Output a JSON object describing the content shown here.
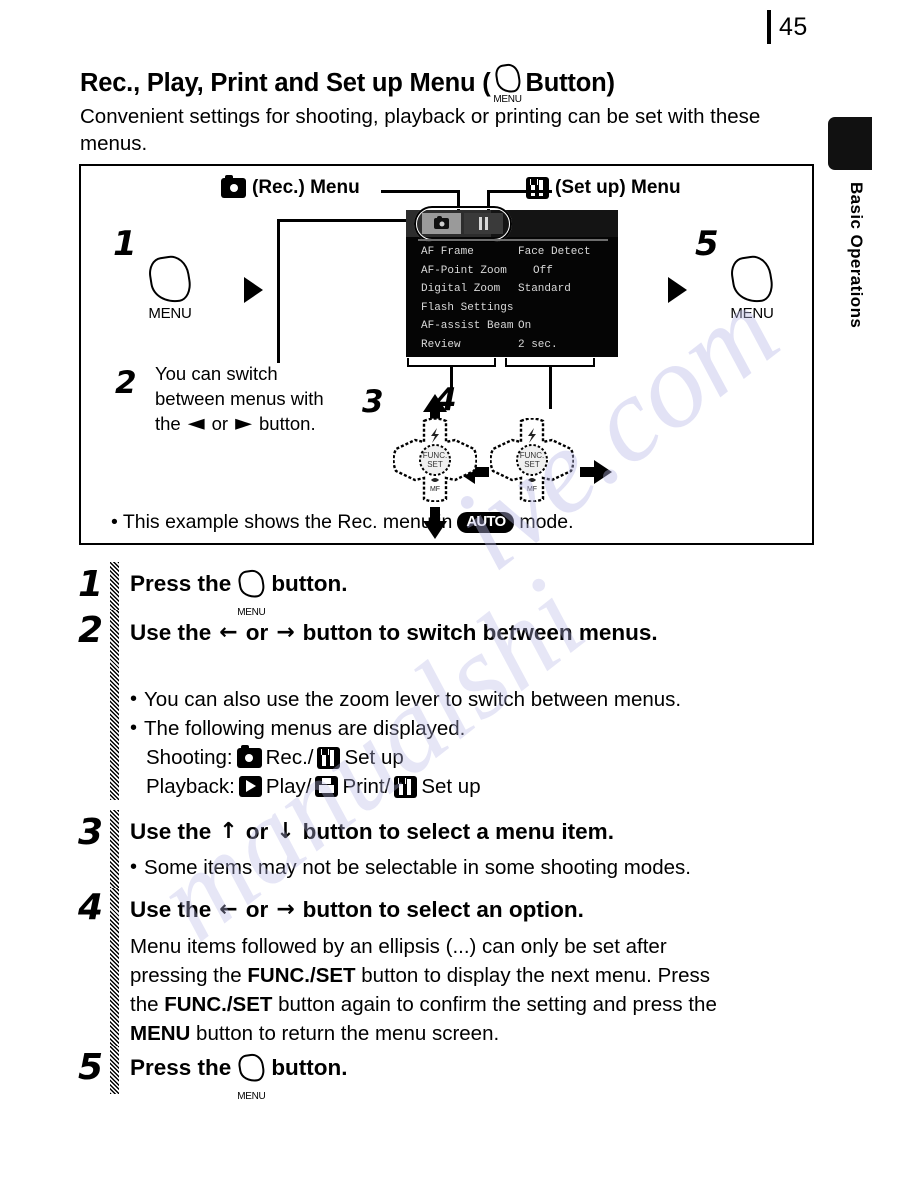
{
  "page": {
    "number": "45",
    "side_tab_label": "Basic Operations",
    "watermark": "ive.com",
    "watermark2": "manualshi"
  },
  "title": {
    "before_icon": "Rec., Play, Print and Set up Menu (",
    "menu_button_caption": "MENU",
    "after_icon": " Button)",
    "menu_icon_name": "menu-button-icon"
  },
  "intro": "Convenient settings for shooting, playback or printing can be set with these menus.",
  "diagram": {
    "label_rec": "(Rec.) Menu",
    "label_setup": "(Set up) Menu",
    "rec_icon_name": "rec-camera-icon",
    "setup_icon_name": "setup-tools-icon",
    "step1_number": "1",
    "step2_number": "2",
    "step3_number": "3",
    "step4_number": "4",
    "step5_number": "5",
    "menu_button_caption": "MENU",
    "step2_text": "You can switch between menus with the ← or → button.",
    "step2_text_part1": "You can switch",
    "step2_text_part2": "between menus with",
    "step2_text_part3a": "the",
    "step2_text_part3b": "or",
    "step2_text_part3c": "button.",
    "arrow_left_glyph": "◄",
    "arrow_right_glyph": "►",
    "footnote_bullet": "•",
    "footnote_before": "This example shows the Rec. menu in",
    "footnote_badge": "AUTO",
    "footnote_after": "mode.",
    "lcd": {
      "tab_rec_icon_name": "lcd-tab-rec-icon",
      "tab_setup_icon_name": "lcd-tab-setup-icon",
      "rows": [
        {
          "label": "AF Frame",
          "value": "Face Detect",
          "narrow": false
        },
        {
          "label": "AF-Point Zoom",
          "value": "Off",
          "narrow": true
        },
        {
          "label": "Digital Zoom",
          "value": "Standard",
          "narrow": false
        },
        {
          "label": "Flash Settings",
          "value": "",
          "narrow": false
        },
        {
          "label": "AF-assist Beam",
          "value": "On",
          "narrow": false
        },
        {
          "label": "Review",
          "value": "2 sec.",
          "narrow": false
        }
      ]
    },
    "dpad": {
      "center_label_1": "FUNC.",
      "center_label_2": "SET",
      "top_icon_name": "flash-icon",
      "bottom_icon_name": "macro-mf-icon"
    }
  },
  "steps": [
    {
      "number": "1",
      "head_before": "Press the",
      "head_menu_caption": "MENU",
      "head_after": "button."
    },
    {
      "number": "2",
      "head_before": "Use the",
      "head_arrow_1": "←",
      "head_mid": "or",
      "head_arrow_2": "→",
      "head_after": "button to switch between menus.",
      "bullets": [
        "You can also use the zoom lever to switch between menus.",
        "The following menus are displayed."
      ],
      "menu_lines": [
        {
          "prefix": "Shooting:",
          "items": [
            {
              "icon": "rec-camera-icon",
              "text": "Rec./"
            },
            {
              "icon": "setup-tools-icon",
              "text": "Set up"
            }
          ]
        },
        {
          "prefix": "Playback:",
          "items": [
            {
              "icon": "play-icon",
              "text": "Play/"
            },
            {
              "icon": "print-icon",
              "text": "Print/"
            },
            {
              "icon": "setup-tools-icon",
              "text": "Set up"
            }
          ]
        }
      ]
    },
    {
      "number": "3",
      "head_before": "Use the",
      "head_arrow_1": "↑",
      "head_mid": "or",
      "head_arrow_2": "↓",
      "head_after": "button to select a menu item.",
      "bullets": [
        "Some items may not be selectable in some shooting modes."
      ]
    },
    {
      "number": "4",
      "head_before": "Use the",
      "head_arrow_1": "←",
      "head_mid": "or",
      "head_arrow_2": "→",
      "head_after": "button to select an option.",
      "body_line1_a": "Menu items followed by an ellipsis (...) can only be set after",
      "body_line2_a": "pressing the ",
      "body_line2_b": "FUNC./SET",
      "body_line2_c": " button to display the next menu. Press",
      "body_line3_a": "the ",
      "body_line3_b": "FUNC./SET",
      "body_line3_c": " button again to confirm the setting and press the",
      "body_line4_a": "MENU",
      "body_line4_b": " button to return the menu screen."
    },
    {
      "number": "5",
      "head_before": "Press the",
      "head_menu_caption": "MENU",
      "head_after": "button."
    }
  ]
}
